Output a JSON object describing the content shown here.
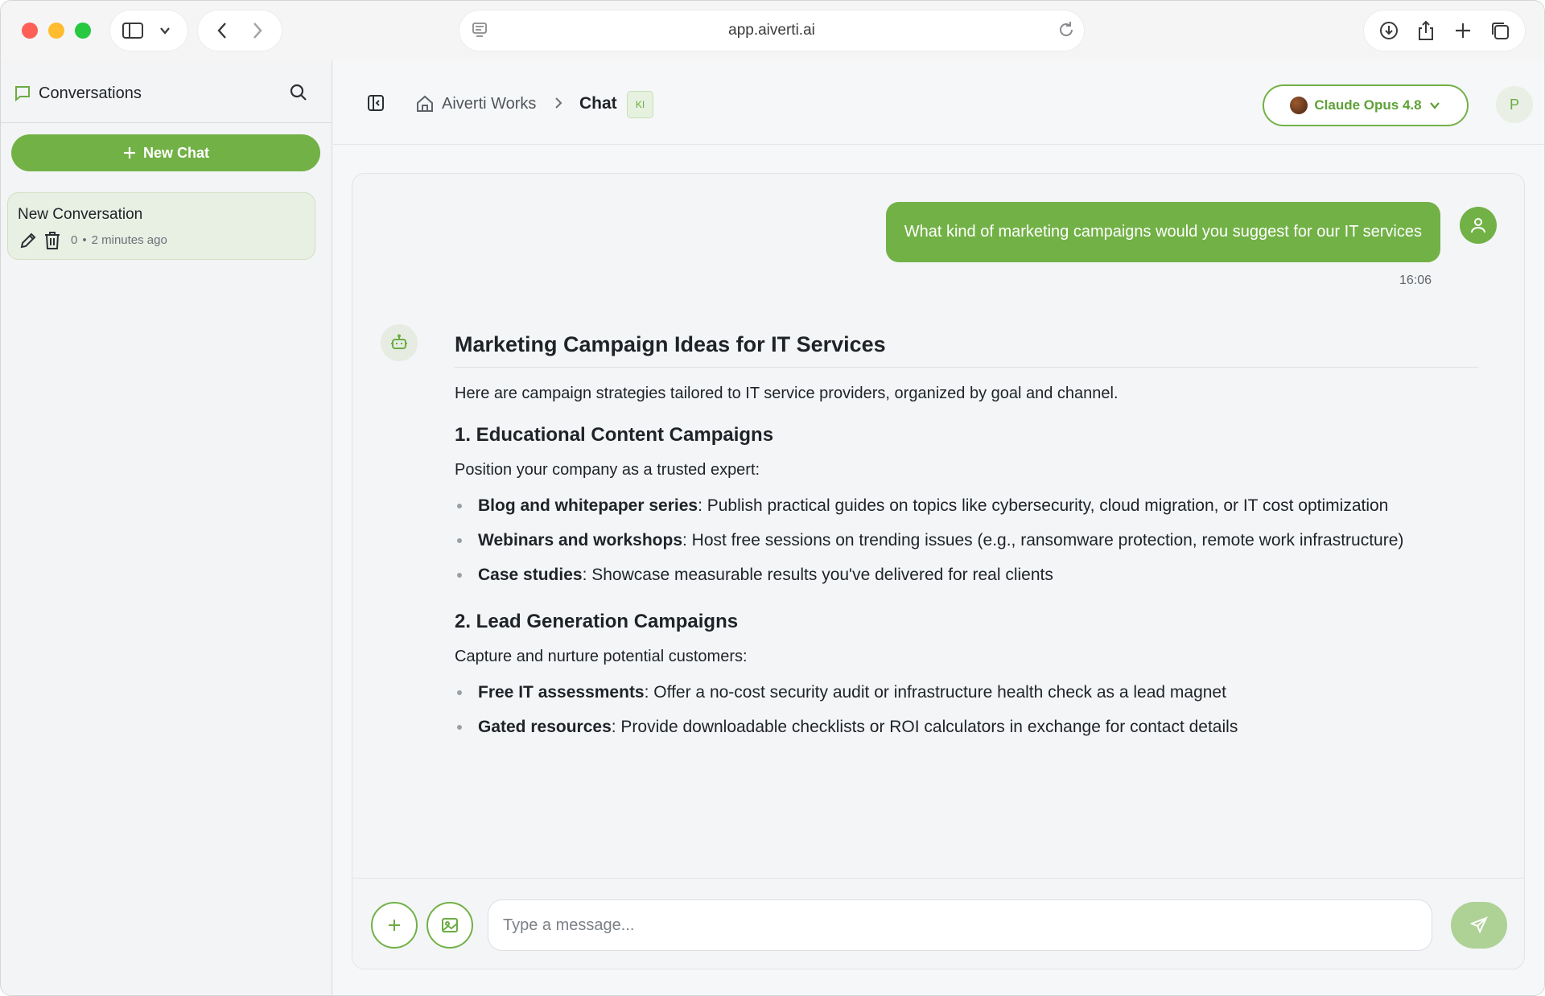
{
  "browser": {
    "url": "app.aiverti.ai"
  },
  "sidebar": {
    "title": "Conversations",
    "new_chat_label": "New Chat",
    "conversations": [
      {
        "title": "New Conversation",
        "count": "0",
        "separator": "•",
        "time": "2 minutes ago"
      }
    ]
  },
  "header": {
    "breadcrumb_root": "Aiverti Works",
    "breadcrumb_current": "Chat",
    "badge": "KI",
    "model_label": "Claude Opus 4.8",
    "avatar_initial": "P"
  },
  "chat": {
    "user_message": "What kind of marketing campaigns would you suggest for our IT services",
    "user_timestamp": "16:06",
    "answer": {
      "title": "Marketing Campaign Ideas for IT Services",
      "intro": "Here are campaign strategies tailored to IT service providers, organized by goal and channel.",
      "sections": [
        {
          "heading": "1. Educational Content Campaigns",
          "lead": "Position your company as a trusted expert:",
          "items": [
            {
              "bold": "Blog and whitepaper series",
              "text": ": Publish practical guides on topics like cybersecurity, cloud migration, or IT cost optimization"
            },
            {
              "bold": "Webinars and workshops",
              "text": ": Host free sessions on trending issues (e.g., ransomware protection, remote work infrastructure)"
            },
            {
              "bold": "Case studies",
              "text": ": Showcase measurable results you've delivered for real clients"
            }
          ]
        },
        {
          "heading": "2. Lead Generation Campaigns",
          "lead": "Capture and nurture potential customers:",
          "items": [
            {
              "bold": "Free IT assessments",
              "text": ": Offer a no-cost security audit or infrastructure health check as a lead magnet"
            },
            {
              "bold": "Gated resources",
              "text": ": Provide downloadable checklists or ROI calculators in exchange for contact details"
            }
          ]
        }
      ]
    }
  },
  "composer": {
    "placeholder": "Type a message..."
  },
  "icons": {
    "sidebar_toggle": "sidebar-icon",
    "search": "search-icon",
    "chat_bubble": "chat-bubble-icon",
    "edit": "pencil-icon",
    "delete": "trash-icon",
    "home": "home-icon",
    "help": "lifebuoy-icon",
    "scroll_down": "arrow-down-icon",
    "send": "send-icon"
  },
  "colors": {
    "accent": "#72b146",
    "accent_light": "#aed196",
    "scroll_button": "#2f5aa6"
  }
}
